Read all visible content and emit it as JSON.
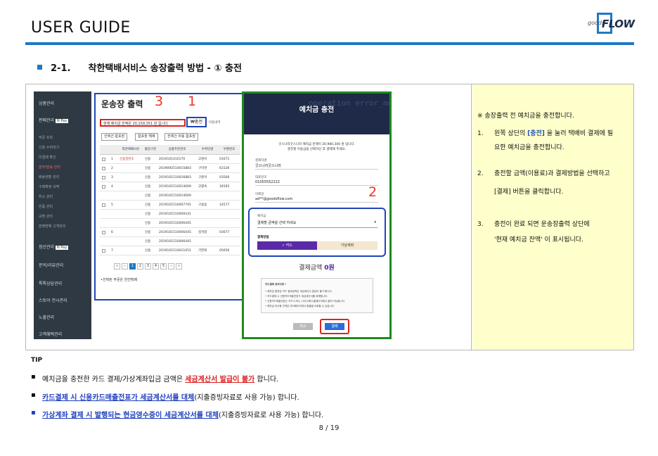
{
  "header": {
    "title": "USER GUIDE",
    "logo_small": "goods",
    "logo_big": "FLOW"
  },
  "section": {
    "number": "2-1.",
    "title": "착한택배서비스 송장출력 방법 - ① 충전"
  },
  "screenshot": {
    "sidebar": {
      "items": [
        "상품관리",
        "판매관리",
        "정산관리",
        "문의/리뷰관리",
        "톡톡상담관리",
        "스토어 전시관리",
        "노출관리",
        "고객혜택관리"
      ],
      "pay_badge": "N Pay",
      "sub_items": [
        "주문 조회",
        "신용 수취대기",
        "미결제 확인",
        "발주/발송 관리",
        "배송현황 관리",
        "구매확정 내역",
        "취소 관리",
        "반품 관리",
        "교환 관리",
        "판매방해 고객관리"
      ]
    },
    "panel": {
      "title": "운송장 출력",
      "warning": "현재 예치금 잔액은 20,159,351 원 입니다",
      "charge_button": "₩충전",
      "small_note": "이용내역",
      "buttons": [
        "선택건 합포장",
        "합포장 해제",
        "전체건 자동 합포장"
      ],
      "columns": [
        "",
        "",
        "착한택배사유",
        "출장구분",
        "상품주문번호",
        "수취인명",
        "우편번호"
      ],
      "rows": [
        {
          "no": "1",
          "reason": "신송장번호",
          "type": "신용",
          "order": "2019101410170",
          "name": "고명서",
          "zip": "01671"
        },
        {
          "no": "2",
          "reason": "",
          "type": "신용",
          "order": "2019092510015883",
          "name": "구미현",
          "zip": "63126"
        },
        {
          "no": "3",
          "reason": "",
          "type": "신용",
          "order": "2019101510016883",
          "name": "구준이",
          "zip": "03566"
        },
        {
          "no": "4",
          "reason": "",
          "type": "신용",
          "order": "2019101510014009",
          "name": "고향숙",
          "zip": "34565"
        },
        {
          "no": "",
          "reason": "",
          "type": "신용",
          "order": "2019101510014009",
          "name": "",
          "zip": ""
        },
        {
          "no": "5",
          "reason": "",
          "type": "신용",
          "order": "2019101510007745",
          "name": "구용동",
          "zip": "14577"
        },
        {
          "no": "",
          "reason": "",
          "type": "신용",
          "order": "2019101510009331",
          "name": "",
          "zip": ""
        },
        {
          "no": "",
          "reason": "",
          "type": "신용",
          "order": "2019101510006445",
          "name": "",
          "zip": ""
        },
        {
          "no": "6",
          "reason": "",
          "type": "신용",
          "order": "2019101510006445",
          "name": "김석정",
          "zip": "03077"
        },
        {
          "no": "",
          "reason": "",
          "type": "신용",
          "order": "2019101510006445",
          "name": "",
          "zip": ""
        },
        {
          "no": "7",
          "reason": "",
          "type": "신용",
          "order": "2019101510011051",
          "name": "기연희",
          "zip": "05656"
        }
      ],
      "pager": [
        "«",
        "‹",
        "1",
        "2",
        "3",
        "4",
        "5",
        "›",
        "»"
      ],
      "filter_text": "•선택된 주문은 한진택배"
    },
    "markers": {
      "one": "1",
      "two": "2",
      "three": "3"
    },
    "modal": {
      "title": "예치금 충전",
      "bg_text": "operation\nerror_mod\nerror_mod",
      "intro1": "굿스나라굿스나라 예치금 잔액이 20,980,300 원 입니다.",
      "intro2": "충전할 이용금을 선택하신 후 결제해 주세요.",
      "fields": [
        {
          "label": "결제자명",
          "value": "굿스나라굿스나라"
        },
        {
          "label": "대표번호",
          "value": "01055552222"
        },
        {
          "label": "이메일",
          "value": "ad**@goodsflow.com"
        }
      ],
      "amount_label": "예치금",
      "amount_placeholder": "결제할 금액을 선택 하세요",
      "method_label": "결제방법",
      "method_card": "✓ 카드",
      "method_va": "가상계좌",
      "amount_text": "결제금액",
      "amount_value": "0원",
      "notice_title": "카드결제 유의사항 !",
      "notice_lines": [
        "• 예치금 충전된 카드 결제금액은 세금계산서 발급이 불가 합니다.",
        "• 카드결제 시 신용카드매출전표가 세금계산서를 대체합니다.",
        "• 신용카드매출전표는 카드사 또는 나이스페이 홈페이지에서 출력 가능합니다.",
        "• 예치금 미사용 잔액은 마이페이지에서 환불을 요청할 수 있습니다."
      ],
      "cancel_button": "취소",
      "pay_button": "결제"
    }
  },
  "note": {
    "head": "※ 송장출력 전 예치금을 충전합니다.",
    "steps": [
      {
        "num": "1.",
        "pre": "왼쪽 상단의 ",
        "hl": "[충전]",
        "post": " 을 눌러 택배비 결제에 필",
        "line2": "요한 예치금을 충전합니다."
      },
      {
        "num": "2.",
        "pre": "충전할 금액(이용료)과 결제방법을 선택하고",
        "hl": "",
        "post": "",
        "line2": "[결제] 버튼을 클릭합니다."
      },
      {
        "num": "3.",
        "pre": "충전이 완료 되면 운송장출력 상단에",
        "hl": "",
        "post": "",
        "line2": "'현재 예치금 잔액' 이 표시됩니다."
      }
    ]
  },
  "tip": {
    "label": "TIP",
    "bullet": "▪",
    "items": [
      {
        "pre": "예치금을 충전한 카드 결제/가상계좌입금 금액은 ",
        "em": "세금계산서 발급이 불가",
        "post": " 합니다."
      },
      {
        "pre": "",
        "em": "카드결제 시  신용카드매출전표가 세금계산서를 대체",
        "post": "(지출증빙자료로 사용 가능) 합니다."
      },
      {
        "pre": "",
        "em": "가상계좌 결제 시 발행되는 현금영수증이 세금계산서를 대체",
        "post": "(지출증빙자료로 사용 가능)  합니다."
      }
    ]
  },
  "page": "8 / 19",
  "colors": {
    "accent": "#1e79c4",
    "marker_red": "#dd2222",
    "modal_green": "#1e8a1e",
    "note_bg": "#ffffcc"
  }
}
